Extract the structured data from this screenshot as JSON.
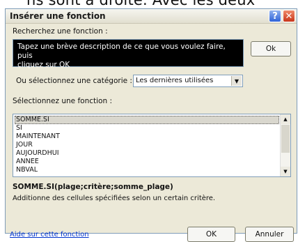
{
  "background_caption": "ns sont à droite. Avec les deux",
  "dialog": {
    "title": "Insérer une fonction",
    "help_glyph": "?",
    "close_glyph": "✕",
    "search_label": "Recherchez une fonction :",
    "search_text_line1": "Tapez une brève description de ce que vous voulez faire, puis",
    "search_text_line2": "cliquez sur OK",
    "ok_search_label": "Ok",
    "category_label": "Ou sélectionnez une catégorie :",
    "category_value": "Les dernières utilisées",
    "function_list_label": "Sélectionnez une fonction :",
    "functions": [
      "SOMME.SI",
      "SI",
      "MAINTENANT",
      "JOUR",
      "AUJOURDHUI",
      "ANNEE",
      "NBVAL"
    ],
    "selected_function_index": 0,
    "function_signature": "SOMME.SI(plage;critère;somme_plage)",
    "function_description": "Additionne des cellules spécifiées selon un certain critère.",
    "help_link": "Aide sur cette fonction",
    "ok_label": "OK",
    "cancel_label": "Annuler"
  }
}
